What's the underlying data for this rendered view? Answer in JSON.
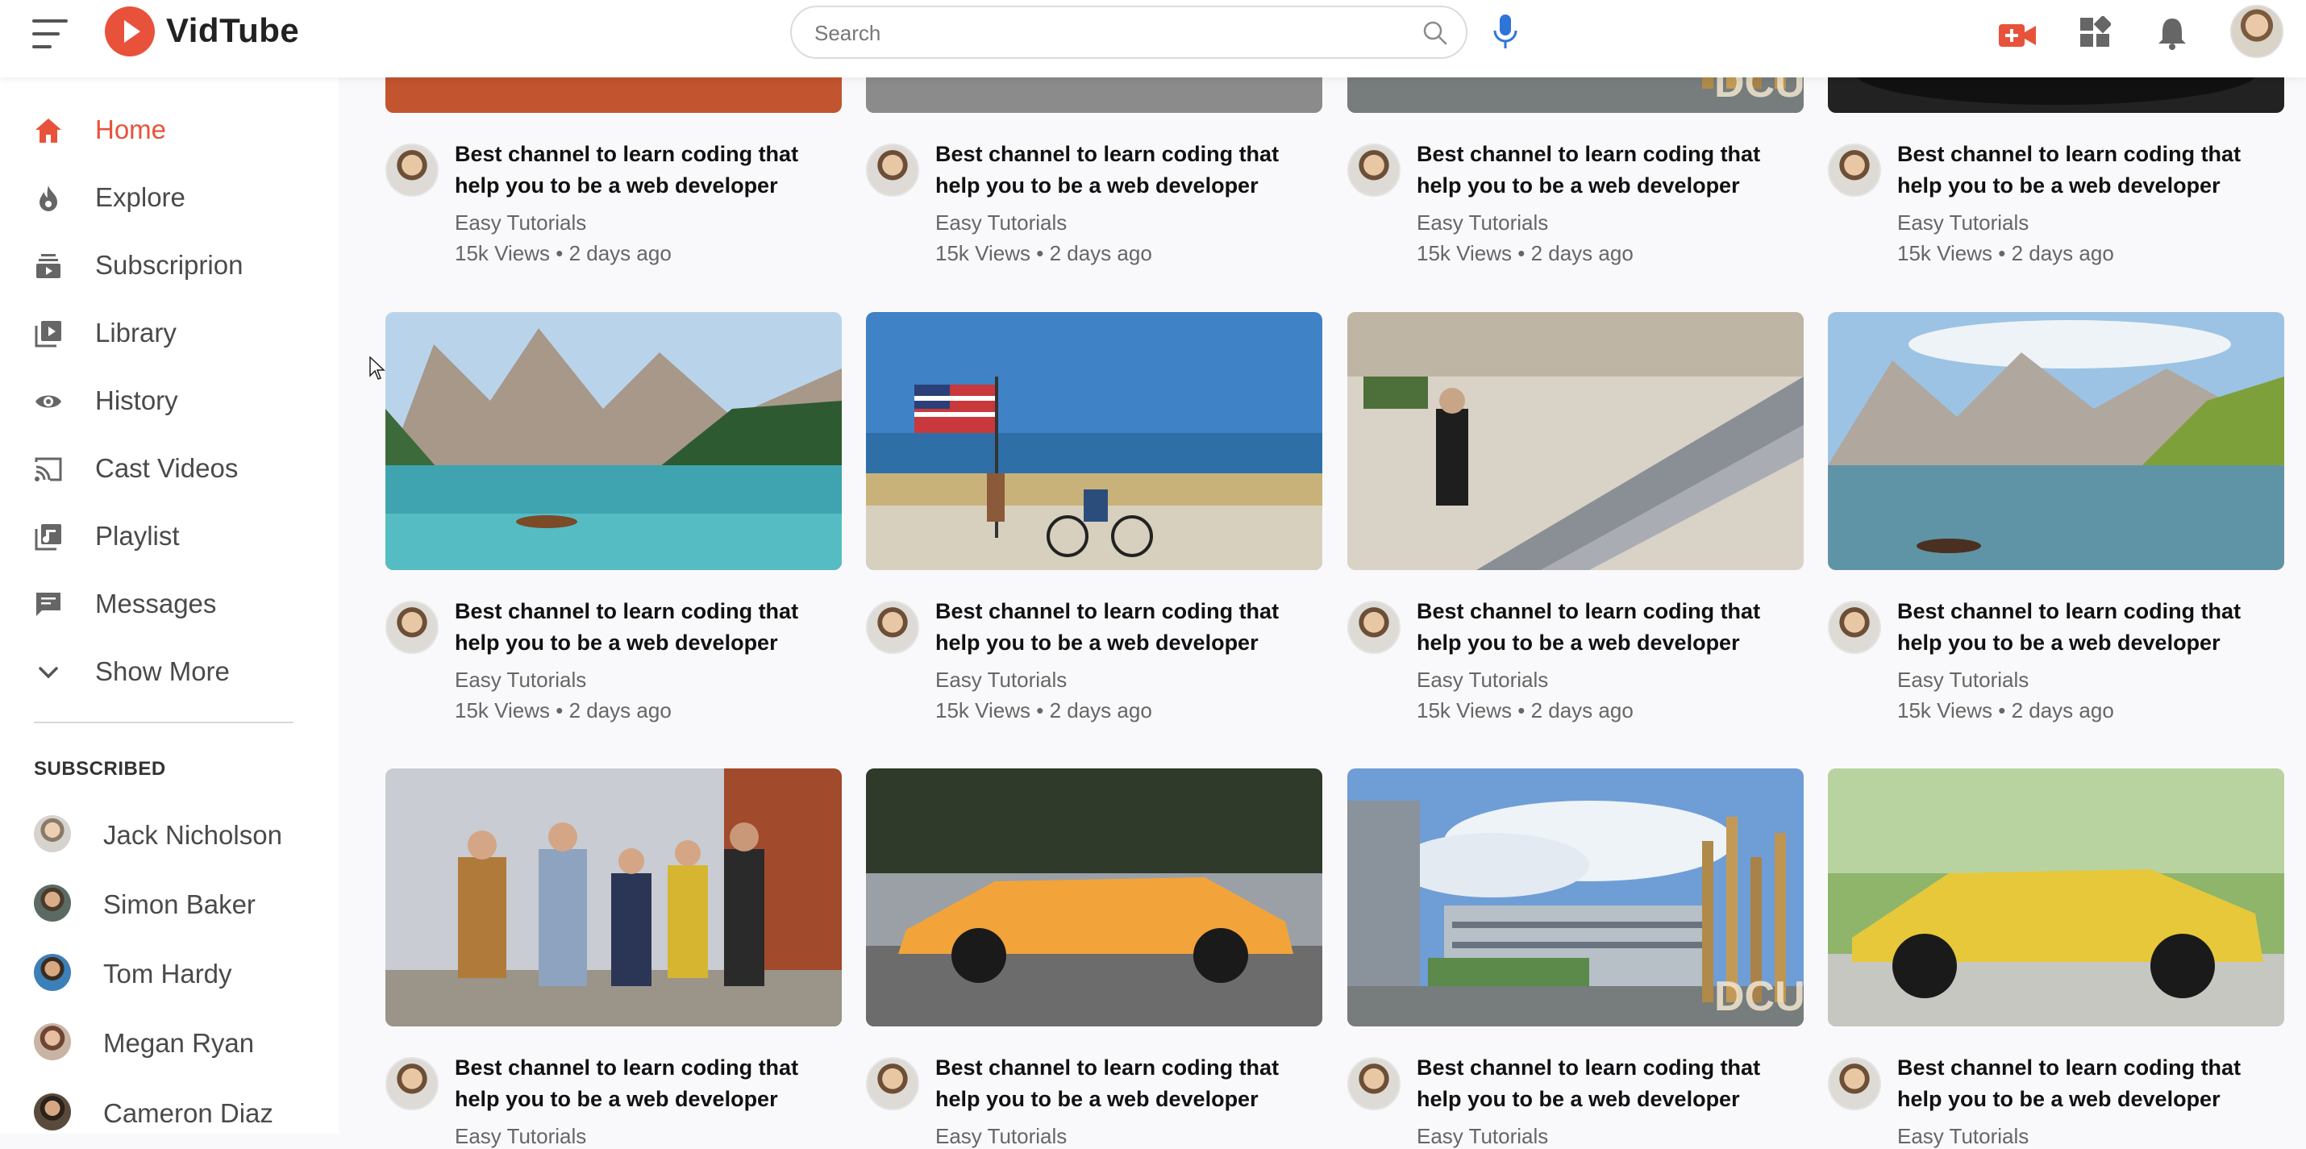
{
  "header": {
    "logo_text": "VidTube",
    "search_placeholder": "Search"
  },
  "colors": {
    "accent": "#e8523b",
    "text": "#1a1a1a",
    "muted": "#666666"
  },
  "icons": [
    "menu-icon",
    "play-logo-icon",
    "search-icon",
    "mic-icon",
    "video-upload-icon",
    "apps-icon",
    "bell-icon"
  ],
  "sidebar": {
    "items": [
      {
        "label": "Home",
        "icon": "home-icon",
        "active": true
      },
      {
        "label": "Explore",
        "icon": "flame-icon"
      },
      {
        "label": "Subscriprion",
        "icon": "subscriptions-icon"
      },
      {
        "label": "Library",
        "icon": "library-icon"
      },
      {
        "label": "History",
        "icon": "eye-icon"
      },
      {
        "label": "Cast Videos",
        "icon": "cast-icon"
      },
      {
        "label": "Playlist",
        "icon": "playlist-icon"
      },
      {
        "label": "Messages",
        "icon": "message-icon"
      },
      {
        "label": "Show More",
        "icon": "chevron-down-icon"
      }
    ],
    "subscribed_heading": "SUBSCRIBED",
    "subscribed": [
      {
        "name": "Jack Nicholson"
      },
      {
        "name": "Simon Baker"
      },
      {
        "name": "Tom Hardy"
      },
      {
        "name": "Megan Ryan"
      },
      {
        "name": "Cameron Diaz"
      }
    ]
  },
  "videos": {
    "rows": [
      [
        {
          "title": "Best channel to learn coding that help you to be a web developer",
          "channel": "Easy Tutorials",
          "meta": "15k Views • 2 days ago"
        },
        {
          "title": "Best channel to learn coding that help you to be a web developer",
          "channel": "Easy Tutorials",
          "meta": "15k Views • 2 days ago"
        },
        {
          "title": "Best channel to learn coding that help you to be a web developer",
          "channel": "Easy Tutorials",
          "meta": "15k Views • 2 days ago"
        },
        {
          "title": "Best channel to learn coding that help you to be a web developer",
          "channel": "Easy Tutorials",
          "meta": "15k Views • 2 days ago"
        }
      ],
      [
        {
          "title": "Best channel to learn coding that help you to be a web developer",
          "channel": "Easy Tutorials",
          "meta": "15k Views • 2 days ago"
        },
        {
          "title": "Best channel to learn coding that help you to be a web developer",
          "channel": "Easy Tutorials",
          "meta": "15k Views • 2 days ago"
        },
        {
          "title": "Best channel to learn coding that help you to be a web developer",
          "channel": "Easy Tutorials",
          "meta": "15k Views • 2 days ago"
        },
        {
          "title": "Best channel to learn coding that help you to be a web developer",
          "channel": "Easy Tutorials",
          "meta": "15k Views • 2 days ago"
        }
      ],
      [
        {
          "title": "Best channel to learn coding that help you to be a web developer",
          "channel": "Easy Tutorials",
          "meta": ""
        },
        {
          "title": "Best channel to learn coding that help you to be a web developer",
          "channel": "Easy Tutorials",
          "meta": ""
        },
        {
          "title": "Best channel to learn coding that help you to be a web developer",
          "channel": "Easy Tutorials",
          "meta": ""
        },
        {
          "title": "Best channel to learn coding that help you to be a web developer",
          "channel": "Easy Tutorials",
          "meta": ""
        }
      ]
    ],
    "thumbnails": [
      "walking-feet",
      "road-asphalt",
      "dcu-campus",
      "sports-car",
      "mountain-lake-boat",
      "flag-runner-beach",
      "escalator-mall",
      "alpine-lake-boat",
      "friends-walking",
      "orange-lamborghini",
      "dcu-campus",
      "yellow-lamborghini"
    ],
    "thumb_watermark": "DCU"
  }
}
